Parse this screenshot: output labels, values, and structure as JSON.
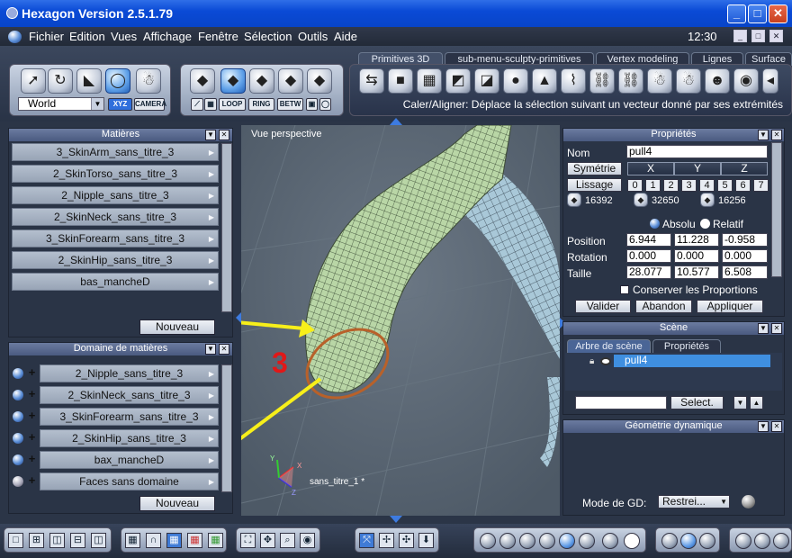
{
  "window": {
    "title": "Hexagon Version 2.5.1.79",
    "min_glyph": "_",
    "max_glyph": "□",
    "close_glyph": "✕"
  },
  "menu": {
    "items": [
      "Fichier",
      "Edition",
      "Vues",
      "Affichage",
      "Fenêtre",
      "Sélection",
      "Outils",
      "Aide"
    ],
    "clock": "12:30"
  },
  "toolbar": {
    "tabs": [
      "Primitives 3D",
      "sub-menu-sculpty-primitives",
      "Vertex modeling",
      "Lignes",
      "Surface"
    ],
    "coord_space": "World",
    "axis_buttons": [
      "XYZ",
      "CAMERA"
    ],
    "select_buttons": [
      "LOOP",
      "RING",
      "BETW"
    ],
    "hint": "Caler/Aligner: Déplace la sélection suivant un vecteur donné par ses extrémités"
  },
  "materials": {
    "title": "Matières",
    "items": [
      "3_SkinArm_sans_titre_3",
      "2_SkinTorso_sans_titre_3",
      "2_Nipple_sans_titre_3",
      "2_SkinNeck_sans_titre_3",
      "3_SkinForearm_sans_titre_3",
      "2_SkinHip_sans_titre_3",
      "bas_mancheD"
    ],
    "new_button": "Nouveau"
  },
  "domains": {
    "title": "Domaine de matières",
    "items": [
      "2_Nipple_sans_titre_3",
      "2_SkinNeck_sans_titre_3",
      "3_SkinForearm_sans_titre_3",
      "2_SkinHip_sans_titre_3",
      "bax_mancheD",
      "Faces sans domaine"
    ],
    "new_button": "Nouveau"
  },
  "viewport": {
    "label": "Vue perspective",
    "scene_name": "sans_titre_1 *",
    "annotation": "3",
    "axes": {
      "x": "X",
      "y": "Y",
      "z": "Z"
    },
    "accent": "#f7ef1a",
    "edge_loop_color": "#b8612a"
  },
  "properties": {
    "title": "Propriétés",
    "name_label": "Nom",
    "name_value": "pull4",
    "symmetry_label": "Symétrie",
    "axes": [
      "X",
      "Y",
      "Z"
    ],
    "smoothing_label": "Lissage",
    "smoothing_levels": [
      "0",
      "1",
      "2",
      "3",
      "4",
      "5",
      "6",
      "7"
    ],
    "counts": [
      "16392",
      "32650",
      "16256"
    ],
    "mode_absolute": "Absolu",
    "mode_relative": "Relatif",
    "rows": [
      {
        "label": "Position",
        "values": [
          "6.944",
          "11.228",
          "-0.958"
        ]
      },
      {
        "label": "Rotation",
        "values": [
          "0.000",
          "0.000",
          "0.000"
        ]
      },
      {
        "label": "Taille",
        "values": [
          "28.077",
          "10.577",
          "6.508"
        ]
      }
    ],
    "keep_proportions": "Conserver les Proportions",
    "buttons": [
      "Valider",
      "Abandon",
      "Appliquer"
    ]
  },
  "scene": {
    "title": "Scène",
    "tabs": [
      "Arbre de scène",
      "Propriétés"
    ],
    "tree_item": "pull4",
    "select_button": "Select."
  },
  "dyn_geometry": {
    "title": "Géométrie dynamique",
    "mode_label": "Mode de GD:",
    "mode_value": "Restrei..."
  }
}
